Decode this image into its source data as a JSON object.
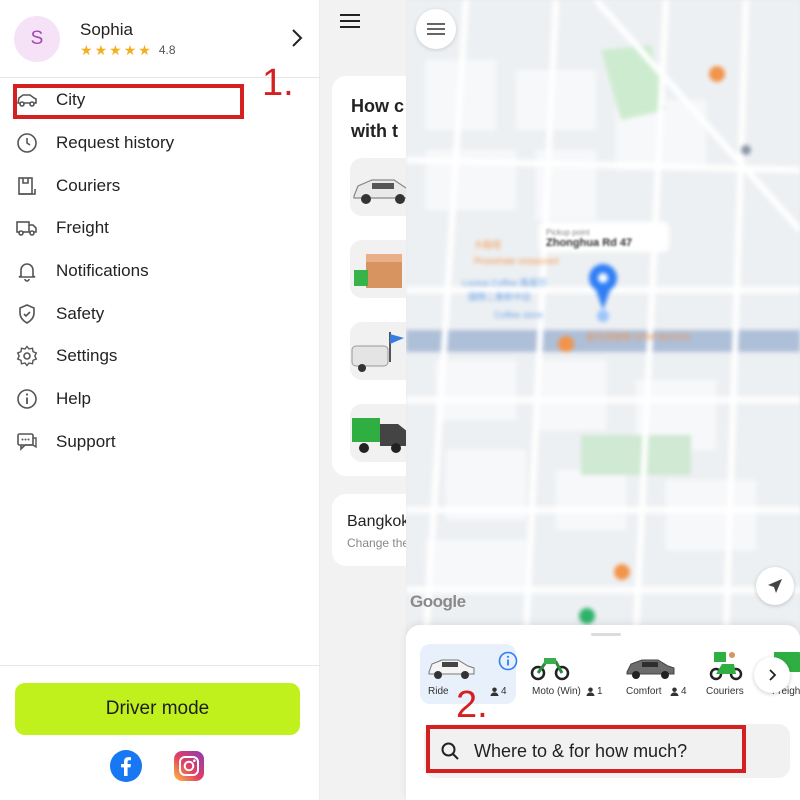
{
  "profile": {
    "avatar_initial": "S",
    "name": "Sophia",
    "rating": "4.8",
    "stars": [
      "★",
      "★",
      "★",
      "★",
      "★"
    ]
  },
  "menu": {
    "items": [
      {
        "label": "City",
        "icon": "car-icon"
      },
      {
        "label": "Request history",
        "icon": "clock-icon"
      },
      {
        "label": "Couriers",
        "icon": "package-icon"
      },
      {
        "label": "Freight",
        "icon": "truck-icon"
      },
      {
        "label": "Notifications",
        "icon": "bell-icon"
      },
      {
        "label": "Safety",
        "icon": "shield-icon"
      },
      {
        "label": "Settings",
        "icon": "gear-icon"
      },
      {
        "label": "Help",
        "icon": "info-icon"
      },
      {
        "label": "Support",
        "icon": "chat-icon"
      }
    ]
  },
  "drawer_bottom": {
    "driver_mode_label": "Driver mode",
    "social": [
      "facebook-icon",
      "instagram-icon"
    ]
  },
  "middle_panel": {
    "headline": "How can we help you\nwith today?",
    "headline_visible": "How c\nwith t",
    "city_name": "Bangkok",
    "city_sub": "Change the city"
  },
  "map": {
    "pickup_label": "Pickup point",
    "pickup_street": "Zhonghua Rd 47",
    "watermark": "Google"
  },
  "sheet": {
    "services": [
      {
        "name": "Ride",
        "seats": "4",
        "selected": true
      },
      {
        "name": "Moto (Win)",
        "seats": "1",
        "selected": false
      },
      {
        "name": "Comfort",
        "seats": "4",
        "selected": false
      },
      {
        "name": "Couriers",
        "seats": "",
        "selected": false
      },
      {
        "name": "Freight",
        "seats": "",
        "selected": false
      }
    ],
    "search_placeholder": "Where to & for how much?"
  },
  "annotations": {
    "step1": "1.",
    "step2": "2."
  },
  "colors": {
    "accent_lime": "#c1f11d",
    "annotation_red": "#d42020",
    "selected_tile": "#e8f0fb",
    "star": "#f2b01e",
    "avatar_bg": "#f6e2f6"
  }
}
